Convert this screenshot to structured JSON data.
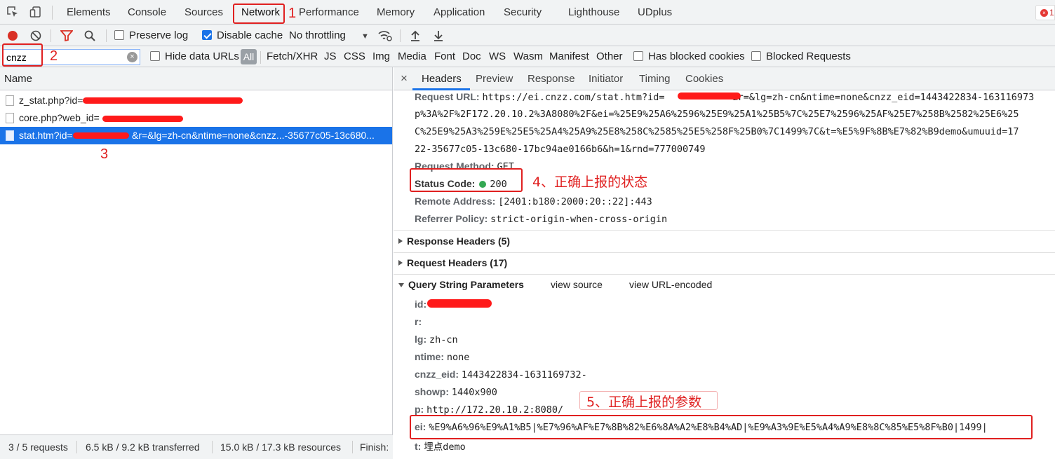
{
  "main_tabs": [
    {
      "label": "Elements"
    },
    {
      "label": "Console"
    },
    {
      "label": "Sources"
    },
    {
      "label": "Network"
    },
    {
      "label": "Performance"
    },
    {
      "label": "Memory"
    },
    {
      "label": "Application"
    },
    {
      "label": "Security"
    },
    {
      "label": "Lighthouse"
    },
    {
      "label": "UDplus"
    }
  ],
  "error_count": "1",
  "toolbar": {
    "preserve_log": "Preserve log",
    "disable_cache": "Disable cache",
    "throttling": "No throttling"
  },
  "filter": {
    "value": "cnzz",
    "hide_data_urls": "Hide data URLs",
    "all": "All",
    "types": [
      "Fetch/XHR",
      "JS",
      "CSS",
      "Img",
      "Media",
      "Font",
      "Doc",
      "WS",
      "Wasm",
      "Manifest",
      "Other"
    ],
    "has_blocked_cookies": "Has blocked cookies",
    "blocked_requests": "Blocked Requests"
  },
  "request_list": {
    "header": "Name",
    "rows": [
      {
        "name": "z_stat.php?id="
      },
      {
        "name": "core.php?web_id="
      },
      {
        "name": "stat.htm?id=",
        "suffix": "&r=&lg=zh-cn&ntime=none&cnzz...-35677c05-13c680..."
      }
    ]
  },
  "status_bar": {
    "requests": "3 / 5 requests",
    "transferred": "6.5 kB / 9.2 kB transferred",
    "resources": "15.0 kB / 17.3 kB resources",
    "finish": "Finish:"
  },
  "detail_tabs": [
    "Headers",
    "Preview",
    "Response",
    "Initiator",
    "Timing",
    "Cookies"
  ],
  "general": {
    "request_url_label": "Request URL:",
    "request_url_line1_a": "https://ei.cnzz.com/stat.htm?id=",
    "request_url_line1_b": "&r=&lg=zh-cn&ntime=none&cnzz_eid=1443422834-163116973",
    "request_url_line2": "p%3A%2F%2F172.20.10.2%3A8080%2F&ei=%25E9%25A6%2596%25E9%25A1%25B5%7C%25E7%2596%25AF%25E7%258B%2582%25E6%25",
    "request_url_line3": "C%25E9%25A3%259E%25E5%25A4%25A9%25E8%258C%2585%25E5%258F%25B0%7C1499%7C&t=%E5%9F%8B%E7%82%B9demo&umuuid=17",
    "request_url_line4": "22-35677c05-13c680-17bc94ae0166b6&h=1&rnd=777000749",
    "request_method_label": "Request Method:",
    "request_method": "GET",
    "status_code_label": "Status Code:",
    "status_code": "200",
    "remote_address_label": "Remote Address:",
    "remote_address": "[2401:b180:2000:20::22]:443",
    "referrer_policy_label": "Referrer Policy:",
    "referrer_policy": "strict-origin-when-cross-origin"
  },
  "sections": {
    "response_headers": "Response Headers (5)",
    "request_headers": "Request Headers (17)",
    "query_string": "Query String Parameters",
    "view_source": "view source",
    "view_url_encoded": "view URL-encoded"
  },
  "params": [
    {
      "key": "id:",
      "value": ""
    },
    {
      "key": "r:",
      "value": ""
    },
    {
      "key": "lg:",
      "value": "zh-cn"
    },
    {
      "key": "ntime:",
      "value": "none"
    },
    {
      "key": "cnzz_eid:",
      "value": "1443422834-1631169732-"
    },
    {
      "key": "showp:",
      "value": "1440x900"
    },
    {
      "key": "p:",
      "value": "http://172.20.10.2:8080/"
    },
    {
      "key": "ei:",
      "value": "%E9%A6%96%E9%A1%B5|%E7%96%AF%E7%8B%82%E6%8A%A2%E8%B4%AD|%E9%A3%9E%E5%A4%A9%E8%8C%85%E5%8F%B0|1499|"
    },
    {
      "key": "t:",
      "value": "埋点demo"
    }
  ],
  "annotations": {
    "n1": "1",
    "n2": "2",
    "n3": "3",
    "n4": "4、正确上报的状态",
    "n5": "5、正确上报的参数"
  },
  "colors": {
    "accent": "#1a73e8",
    "annotation": "#e02020",
    "status_ok": "#34a853",
    "record": "#d93025"
  }
}
